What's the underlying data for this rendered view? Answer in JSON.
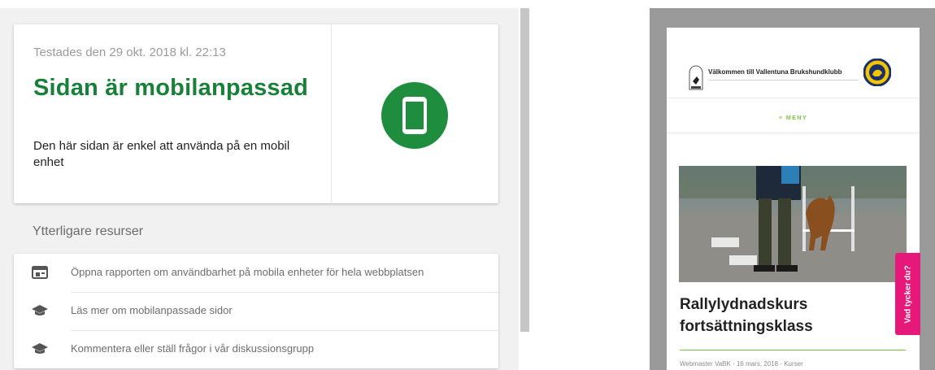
{
  "result": {
    "tested_text": "Testades den 29 okt. 2018 kl. 22:13",
    "headline": "Sidan är mobilanpassad",
    "description": "Den här sidan är enkel att använda på en mobil enhet",
    "status_icon": "smartphone-icon",
    "status_color": "#1e8e3e"
  },
  "resources": {
    "title": "Ytterligare resurser",
    "items": [
      {
        "icon": "report-icon",
        "label": "Öppna rapporten om användbarhet på mobila enheter för hela webbplatsen"
      },
      {
        "icon": "graduation-cap-icon",
        "label": "Läs mer om mobilanpassade sidor"
      },
      {
        "icon": "graduation-cap-icon",
        "label": "Kommentera eller ställ frågor i vår diskussionsgrupp"
      }
    ]
  },
  "preview": {
    "site_title": "Välkommen till Vallentuna Brukshundklubb",
    "menu_label": "≡  MENY",
    "post_title": "Rallylydnadskurs fortsättningsklass",
    "meta": "Webmaster VaBK  ·  16 mars, 2018  ·  Kurser",
    "feedback_label": "Vad tycker du?",
    "accent_color": "#7ac142",
    "feedback_color": "#e6197a"
  }
}
